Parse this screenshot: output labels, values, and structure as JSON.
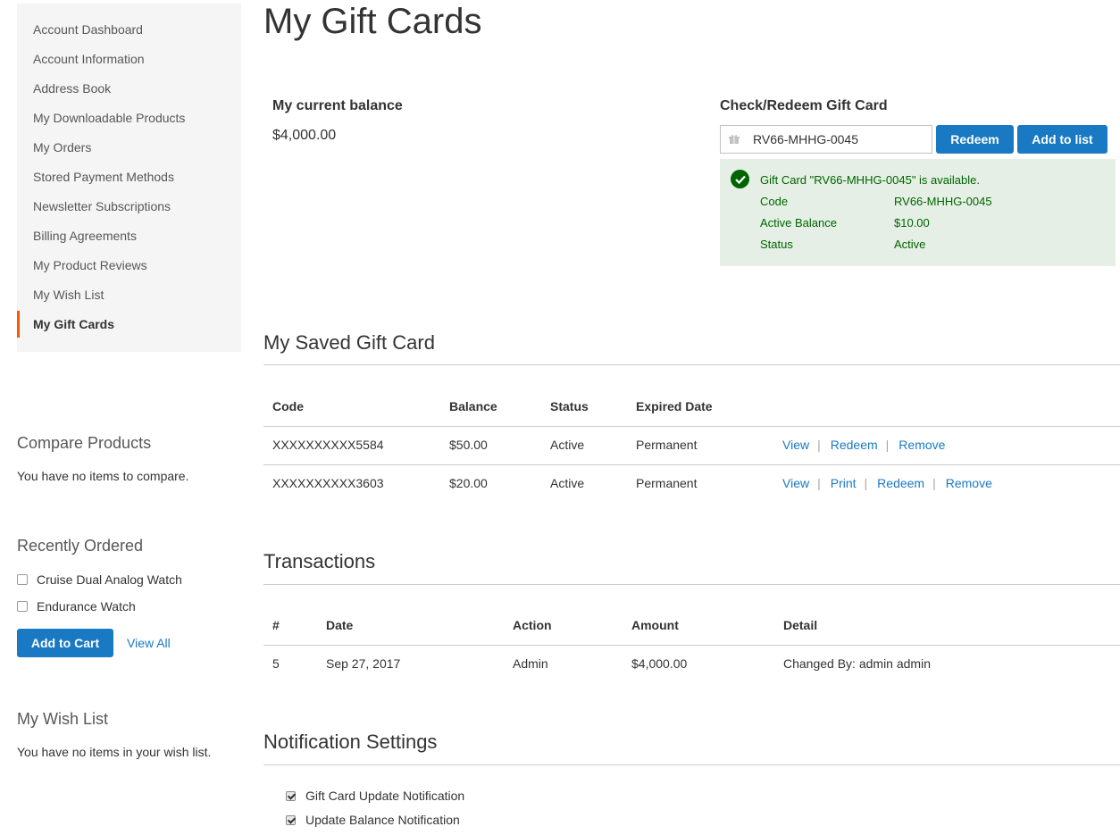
{
  "sidebar": {
    "items": [
      {
        "label": "Account Dashboard"
      },
      {
        "label": "Account Information"
      },
      {
        "label": "Address Book"
      },
      {
        "label": "My Downloadable Products"
      },
      {
        "label": "My Orders"
      },
      {
        "label": "Stored Payment Methods"
      },
      {
        "label": "Newsletter Subscriptions"
      },
      {
        "label": "Billing Agreements"
      },
      {
        "label": "My Product Reviews"
      },
      {
        "label": "My Wish List"
      },
      {
        "label": "My Gift Cards",
        "active": true
      }
    ],
    "compare": {
      "title": "Compare Products",
      "text": "You have no items to compare."
    },
    "recently_ordered": {
      "title": "Recently Ordered",
      "items": [
        "Cruise Dual Analog Watch",
        "Endurance Watch"
      ],
      "add_to_cart": "Add to Cart",
      "view_all": "View All"
    },
    "wishlist": {
      "title": "My Wish List",
      "text": "You have no items in your wish list."
    }
  },
  "page": {
    "title": "My Gift Cards"
  },
  "balance": {
    "title": "My current balance",
    "value": "$4,000.00"
  },
  "redeem": {
    "title": "Check/Redeem Gift Card",
    "input_value": "RV66-MHHG-0045",
    "redeem_label": "Redeem",
    "add_label": "Add to list",
    "message": {
      "text": "Gift Card \"RV66-MHHG-0045\" is available.",
      "rows": [
        {
          "k": "Code",
          "v": "RV66-MHHG-0045"
        },
        {
          "k": "Active Balance",
          "v": "$10.00"
        },
        {
          "k": "Status",
          "v": "Active"
        }
      ]
    }
  },
  "saved": {
    "title": "My Saved Gift Card",
    "headers": [
      "Code",
      "Balance",
      "Status",
      "Expired Date"
    ],
    "rows": [
      {
        "code": "XXXXXXXXXX5584",
        "balance": "$50.00",
        "status": "Active",
        "expired": "Permanent",
        "actions": [
          "View",
          "Redeem",
          "Remove"
        ]
      },
      {
        "code": "XXXXXXXXXX3603",
        "balance": "$20.00",
        "status": "Active",
        "expired": "Permanent",
        "actions": [
          "View",
          "Print",
          "Redeem",
          "Remove"
        ]
      }
    ]
  },
  "transactions": {
    "title": "Transactions",
    "headers": [
      "#",
      "Date",
      "Action",
      "Amount",
      "Detail"
    ],
    "rows": [
      {
        "num": "5",
        "date": "Sep 27, 2017",
        "action": "Admin",
        "amount": "$4,000.00",
        "detail": "Changed By: admin admin"
      }
    ]
  },
  "notifications": {
    "title": "Notification Settings",
    "items": [
      {
        "label": "Gift Card Update Notification",
        "checked": true
      },
      {
        "label": "Update Balance Notification",
        "checked": true
      }
    ]
  },
  "colors": {
    "accent": "#1979c3",
    "active_marker": "#ff5501",
    "success_bg": "#e5efe5",
    "success_text": "#006400"
  }
}
